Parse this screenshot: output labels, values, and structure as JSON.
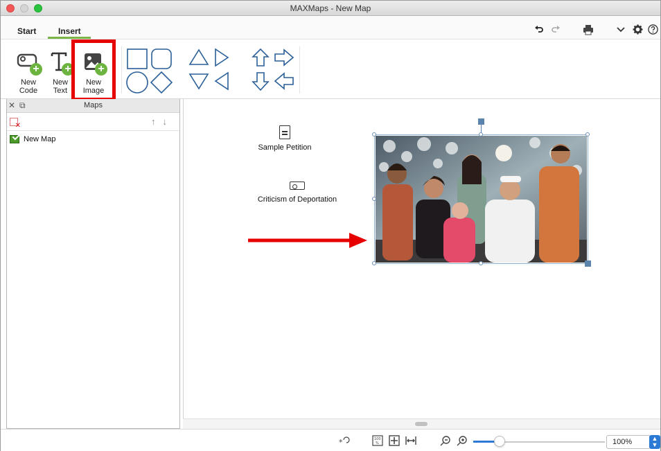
{
  "window": {
    "title": "MAXMaps - New Map"
  },
  "tabs": [
    {
      "label": "Start"
    },
    {
      "label": "Insert"
    }
  ],
  "quick_icons": [
    "undo-icon",
    "redo-icon",
    "print-icon",
    "chevron-down-icon",
    "gear-icon",
    "help-icon"
  ],
  "ribbon": {
    "new_code": "New\nCode",
    "new_text": "New\nText",
    "new_image": "New\nImage",
    "shapes": [
      "rectangle-shape",
      "rounded-rectangle-shape",
      "circle-shape",
      "diamond-shape",
      "triangle-up-shape",
      "triangle-right-shape",
      "triangle-down-shape",
      "triangle-left-shape",
      "arrow-up-shape",
      "arrow-right-shape",
      "arrow-down-shape",
      "arrow-left-shape"
    ]
  },
  "maps_panel": {
    "title": "Maps",
    "items": [
      {
        "label": "New Map"
      }
    ]
  },
  "canvas": {
    "nodes": [
      {
        "label": "Sample Petition"
      },
      {
        "label": "Criticism of Deportation"
      }
    ]
  },
  "status_bar": {
    "zoom_level": "100%",
    "zoom_fraction": 0.2
  },
  "colors": {
    "accent_green": "#7ab648",
    "highlight_red": "#e60000",
    "selection_blue": "#5b84ad",
    "zoom_blue": "#2d7ad6"
  }
}
